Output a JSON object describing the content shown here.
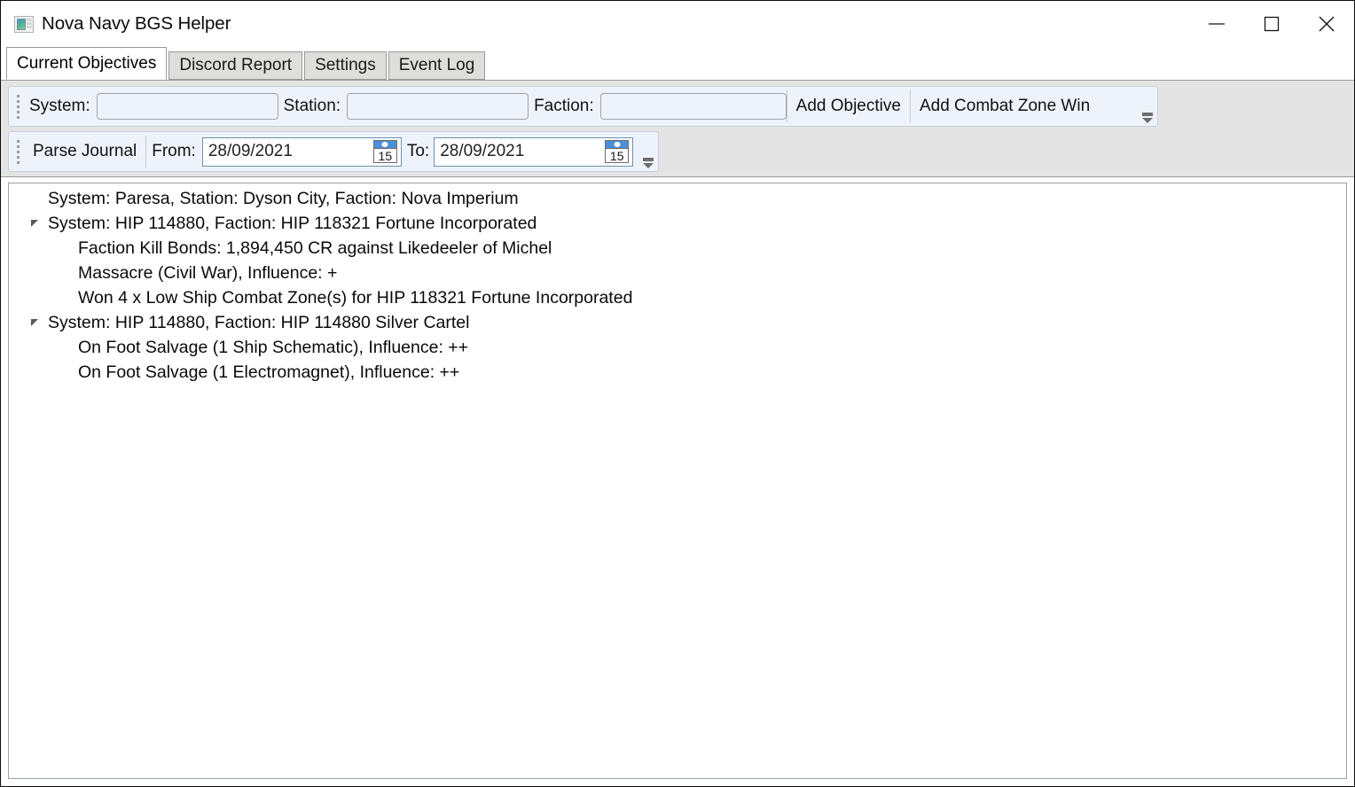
{
  "window": {
    "title": "Nova Navy BGS Helper",
    "icon": "app-window-icon",
    "controls": {
      "minimize": "minimize-icon",
      "maximize": "maximize-icon",
      "close": "close-icon"
    }
  },
  "tabs": [
    {
      "label": "Current Objectives",
      "active": true
    },
    {
      "label": "Discord Report",
      "active": false
    },
    {
      "label": "Settings",
      "active": false
    },
    {
      "label": "Event Log",
      "active": false
    }
  ],
  "toolbar_objectives": {
    "grip": "toolbar-grip",
    "system_label": "System:",
    "system_value": "",
    "system_placeholder": "",
    "station_label": "Station:",
    "station_value": "",
    "station_placeholder": "",
    "faction_label": "Faction:",
    "faction_value": "",
    "faction_placeholder": "",
    "add_objective_label": "Add Objective",
    "add_combat_zone_win_label": "Add Combat Zone Win",
    "overflow": "toolbar-overflow-icon"
  },
  "toolbar_journal": {
    "grip": "toolbar-grip",
    "parse_journal_label": "Parse Journal",
    "from_label": "From:",
    "from_value": "28/09/2021",
    "to_label": "To:",
    "to_value": "28/09/2021",
    "calendar_day": "15",
    "overflow": "toolbar-overflow-icon"
  },
  "tree": {
    "nodes": [
      {
        "text": "System: Paresa, Station: Dyson City, Faction: Nova Imperium",
        "level": 0,
        "expander": false
      },
      {
        "text": "System: HIP 114880, Faction: HIP 118321 Fortune Incorporated",
        "level": 0,
        "expander": true
      },
      {
        "text": "Faction Kill Bonds: 1,894,450 CR against Likedeeler of Michel",
        "level": 1,
        "expander": false
      },
      {
        "text": "Massacre (Civil War), Influence: +",
        "level": 1,
        "expander": false
      },
      {
        "text": "Won 4 x Low Ship Combat Zone(s) for HIP 118321 Fortune Incorporated",
        "level": 1,
        "expander": false
      },
      {
        "text": "System: HIP 114880, Faction: HIP 114880 Silver Cartel",
        "level": 0,
        "expander": true
      },
      {
        "text": "On Foot Salvage (1 Ship Schematic), Influence: ++",
        "level": 1,
        "expander": false
      },
      {
        "text": "On Foot Salvage (1 Electromagnet), Influence: ++",
        "level": 1,
        "expander": false
      }
    ]
  },
  "colors": {
    "toolbar_bg": "#eef3fb",
    "toolbar_host_bg": "#e4e4e4",
    "tab_inactive_bg": "#dededc",
    "calendar_accent": "#4a90d9",
    "border": "#9a9a9a"
  }
}
